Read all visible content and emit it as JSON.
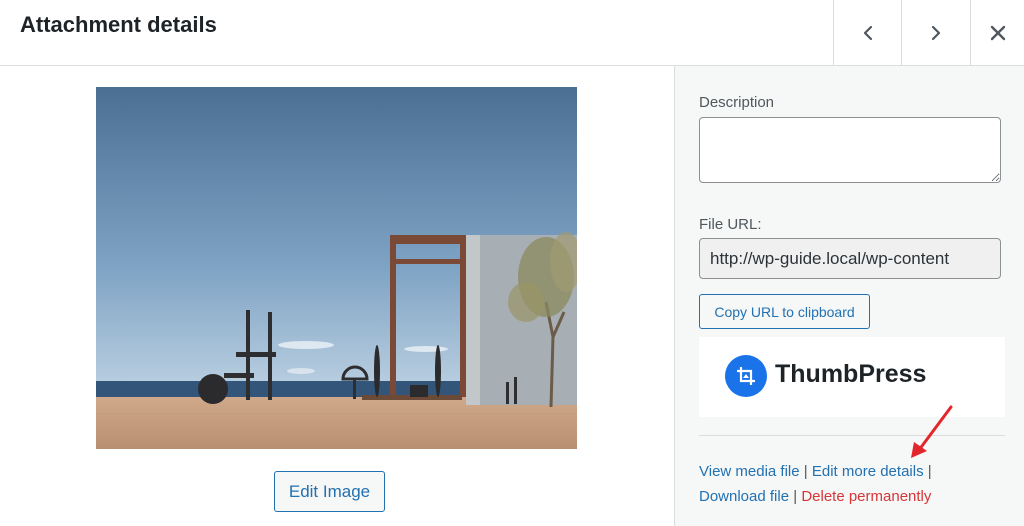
{
  "header": {
    "title": "Attachment details"
  },
  "media": {
    "edit_image_label": "Edit Image"
  },
  "sidebar": {
    "description_label": "Description",
    "description_value": "",
    "file_url_label": "File URL:",
    "file_url_value": "http://wp-guide.local/wp-content",
    "copy_url_label": "Copy URL to clipboard",
    "thumbpress_name": "ThumbPress",
    "links": {
      "view_media": "View media file",
      "edit_details": "Edit more details",
      "download": "Download file",
      "delete": "Delete permanently",
      "separator": "|"
    }
  },
  "colors": {
    "link": "#2271b1",
    "danger": "#d63638",
    "thumbpress_blue": "#1a73e8",
    "annotation_arrow": "#e3262b"
  },
  "icons": {
    "prev": "chevron-left-icon",
    "next": "chevron-right-icon",
    "close": "close-icon",
    "logo": "thumbpress-crop-icon",
    "annotation": "red-arrow-icon"
  }
}
